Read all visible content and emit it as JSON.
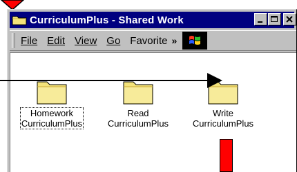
{
  "window": {
    "title": "CurriculumPlus - Shared Work",
    "buttons": [
      "minimize",
      "maximize",
      "close"
    ]
  },
  "menubar": {
    "items": [
      {
        "label": "File"
      },
      {
        "label": "Edit"
      },
      {
        "label": "View"
      },
      {
        "label": "Go"
      },
      {
        "label": "Favorite"
      }
    ],
    "overflow": "»"
  },
  "folders": [
    {
      "line1": "Homework",
      "line2": "CurriculumPlus"
    },
    {
      "line1": "Read",
      "line2": "CurriculumPlus"
    },
    {
      "line1": "Write",
      "line2": "CurriculumPlus"
    }
  ],
  "colors": {
    "titlebar": "#000080",
    "annotation": "#ff0000",
    "folder": "#f4e37a"
  },
  "icons": [
    "folder-icon",
    "windows-logo-icon",
    "minimize-icon",
    "maximize-icon",
    "close-icon"
  ]
}
